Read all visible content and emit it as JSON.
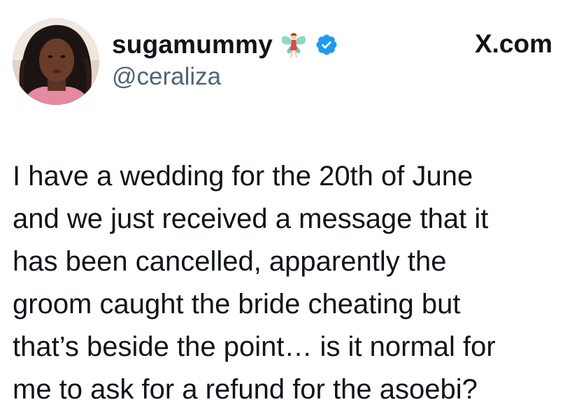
{
  "tweet": {
    "author": {
      "display_name": "sugamummy",
      "handle": "@ceraliza",
      "name_emoji": "fairy-icon",
      "verified_badge": "verified-badge-icon",
      "avatar": "profile-photo"
    },
    "source": "X.com",
    "text": "I have a wedding for the 20th of June\nand we just received a message that it\nhas been cancelled, apparently the\ngroom caught the bride cheating but\nthat’s beside the point… is it normal for\nme to ask for a refund for the asoebi?"
  },
  "colors": {
    "text_primary": "#0f1419",
    "text_secondary": "#536471",
    "verified_blue": "#1d9bf0",
    "background": "#ffffff"
  }
}
